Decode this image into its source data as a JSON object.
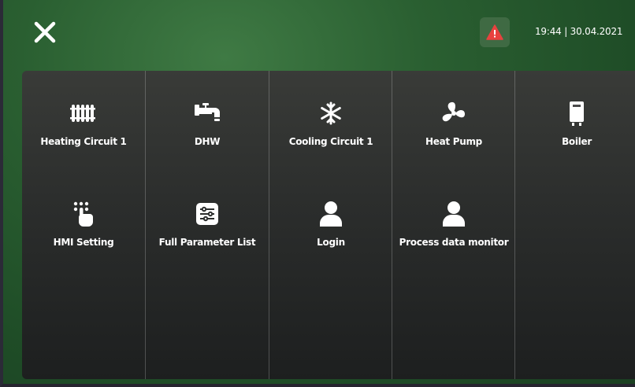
{
  "header": {
    "close_icon": "close-icon",
    "alarm_icon": "warning-triangle-icon",
    "alarm_color": "#e8423f",
    "datetime": "19:44 | 30.04.2021"
  },
  "menu": {
    "items": [
      {
        "label": "Heating Circuit 1",
        "icon": "radiator-icon"
      },
      {
        "label": "DHW",
        "icon": "faucet-icon"
      },
      {
        "label": "Cooling Circuit 1",
        "icon": "snowflake-icon"
      },
      {
        "label": "Heat Pump",
        "icon": "fan-icon"
      },
      {
        "label": "Boiler",
        "icon": "boiler-icon"
      },
      {
        "label": "HMI Setting",
        "icon": "touch-hand-icon"
      },
      {
        "label": "Full Parameter List",
        "icon": "sliders-list-icon"
      },
      {
        "label": "Login",
        "icon": "user-icon"
      },
      {
        "label": "Process data monitor",
        "icon": "user-icon"
      }
    ]
  }
}
